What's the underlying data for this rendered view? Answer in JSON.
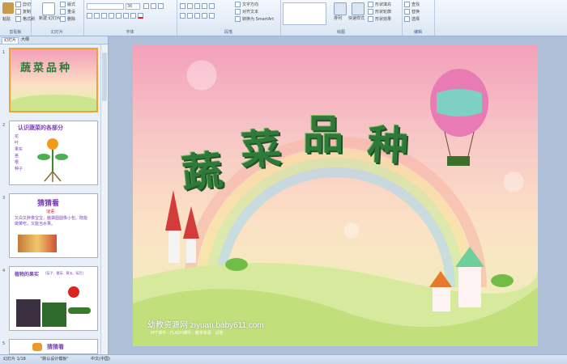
{
  "ribbon": {
    "clipboard": {
      "paste": "粘贴",
      "cut": "剪切",
      "copy": "复制",
      "format_painter": "格式刷",
      "label": "剪贴板"
    },
    "slides": {
      "new_slide": "新建\n幻灯片",
      "layout": "版式",
      "reset": "重设",
      "delete": "删除",
      "label": "幻灯片"
    },
    "font": {
      "font_name": "",
      "font_size": "36",
      "label": "字体"
    },
    "paragraph": {
      "text_direction": "文字方向",
      "align_text": "对齐文本",
      "smartart": "转换为 SmartArt",
      "label": "段落"
    },
    "drawing": {
      "arrange": "排列",
      "quick_styles": "快速样式",
      "shape_fill": "形状填充",
      "shape_outline": "形状轮廓",
      "shape_effects": "形状效果",
      "label": "绘图"
    },
    "editing": {
      "find": "查找",
      "replace": "替换",
      "select": "选择",
      "label": "编辑"
    }
  },
  "left_pane": {
    "tabs": [
      "幻灯片",
      "大纲"
    ],
    "slides": [
      {
        "num": "1",
        "title": "蔬菜品种"
      },
      {
        "num": "2",
        "title": "认识蔬菜的各部分",
        "labels": [
          "花",
          "叶",
          "果实",
          "茎",
          "根",
          "种子"
        ]
      },
      {
        "num": "3",
        "title": "猜猜看",
        "sub": "谜语",
        "text": "又白又胖像宝宝，脑袋圆圆像小包。既能做菜吃，又能当水果。"
      },
      {
        "num": "4",
        "title": "植物的果实",
        "sub": "(茄子、番茄、黄瓜、豌豆)"
      },
      {
        "num": "5",
        "title": "猜猜看"
      }
    ]
  },
  "slide": {
    "title_chars": [
      "蔬",
      "菜",
      "品",
      "种"
    ],
    "watermark": "幼教资源网 ziyuan.baby611.com",
    "watermark_sub": "PPT课件 · FLASH课件 · 教学资源 · 试卷"
  },
  "status": {
    "slide_pos": "幻灯片 1/18",
    "theme": "\"默认设计模板\"",
    "language": "中文(中国)"
  },
  "colors": {
    "ribbon_top": "#f4f8fd",
    "ribbon_bottom": "#dbe6f4",
    "accent": "#f2a03a",
    "title_green": "#2f7a3a"
  }
}
